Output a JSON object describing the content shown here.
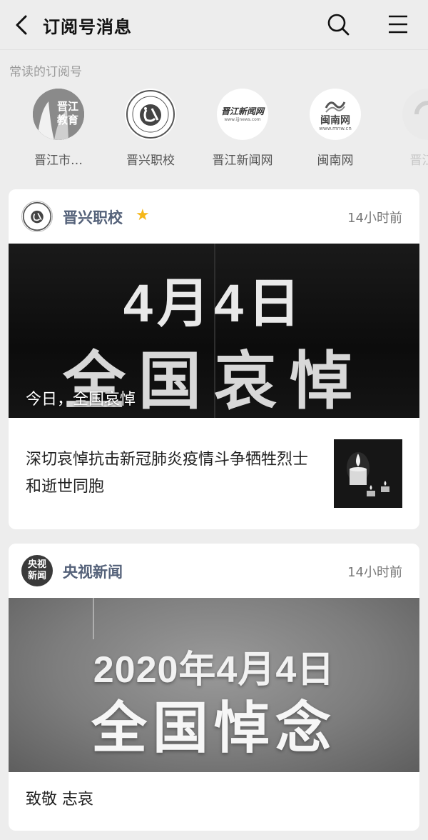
{
  "header": {
    "title": "订阅号消息",
    "back_icon": "chevron-left-icon",
    "search_icon": "search-icon",
    "menu_icon": "hamburger-menu-icon"
  },
  "frequent": {
    "label": "常读的订阅号",
    "items": [
      {
        "name": "晋江市…",
        "avatar_text": "晋江教育"
      },
      {
        "name": "晋兴职校",
        "avatar_text": ""
      },
      {
        "name": "晋江新闻网",
        "avatar_text": "晋江新闻网",
        "avatar_sub": "www.ijjnews.com"
      },
      {
        "name": "闽南网",
        "avatar_text": "闽南网",
        "avatar_sub": "www.mnw.cn"
      },
      {
        "name": "晋江电",
        "avatar_text": ""
      }
    ]
  },
  "cards": [
    {
      "source": "晋兴职校",
      "starred": true,
      "time": "14小时前",
      "banner_line1": "4月4日",
      "banner_line2": "全国哀悼",
      "banner_caption": "今日，全国哀悼",
      "article_title": "深切哀悼抗击新冠肺炎疫情斗争牺牲烈士和逝世同胞"
    },
    {
      "source": "央视新闻",
      "avatar_text": "央视新闻",
      "time": "14小时前",
      "banner_line1": "2020年4月4日",
      "banner_line2": "全国悼念",
      "article_title": "致敬 志哀"
    }
  ]
}
